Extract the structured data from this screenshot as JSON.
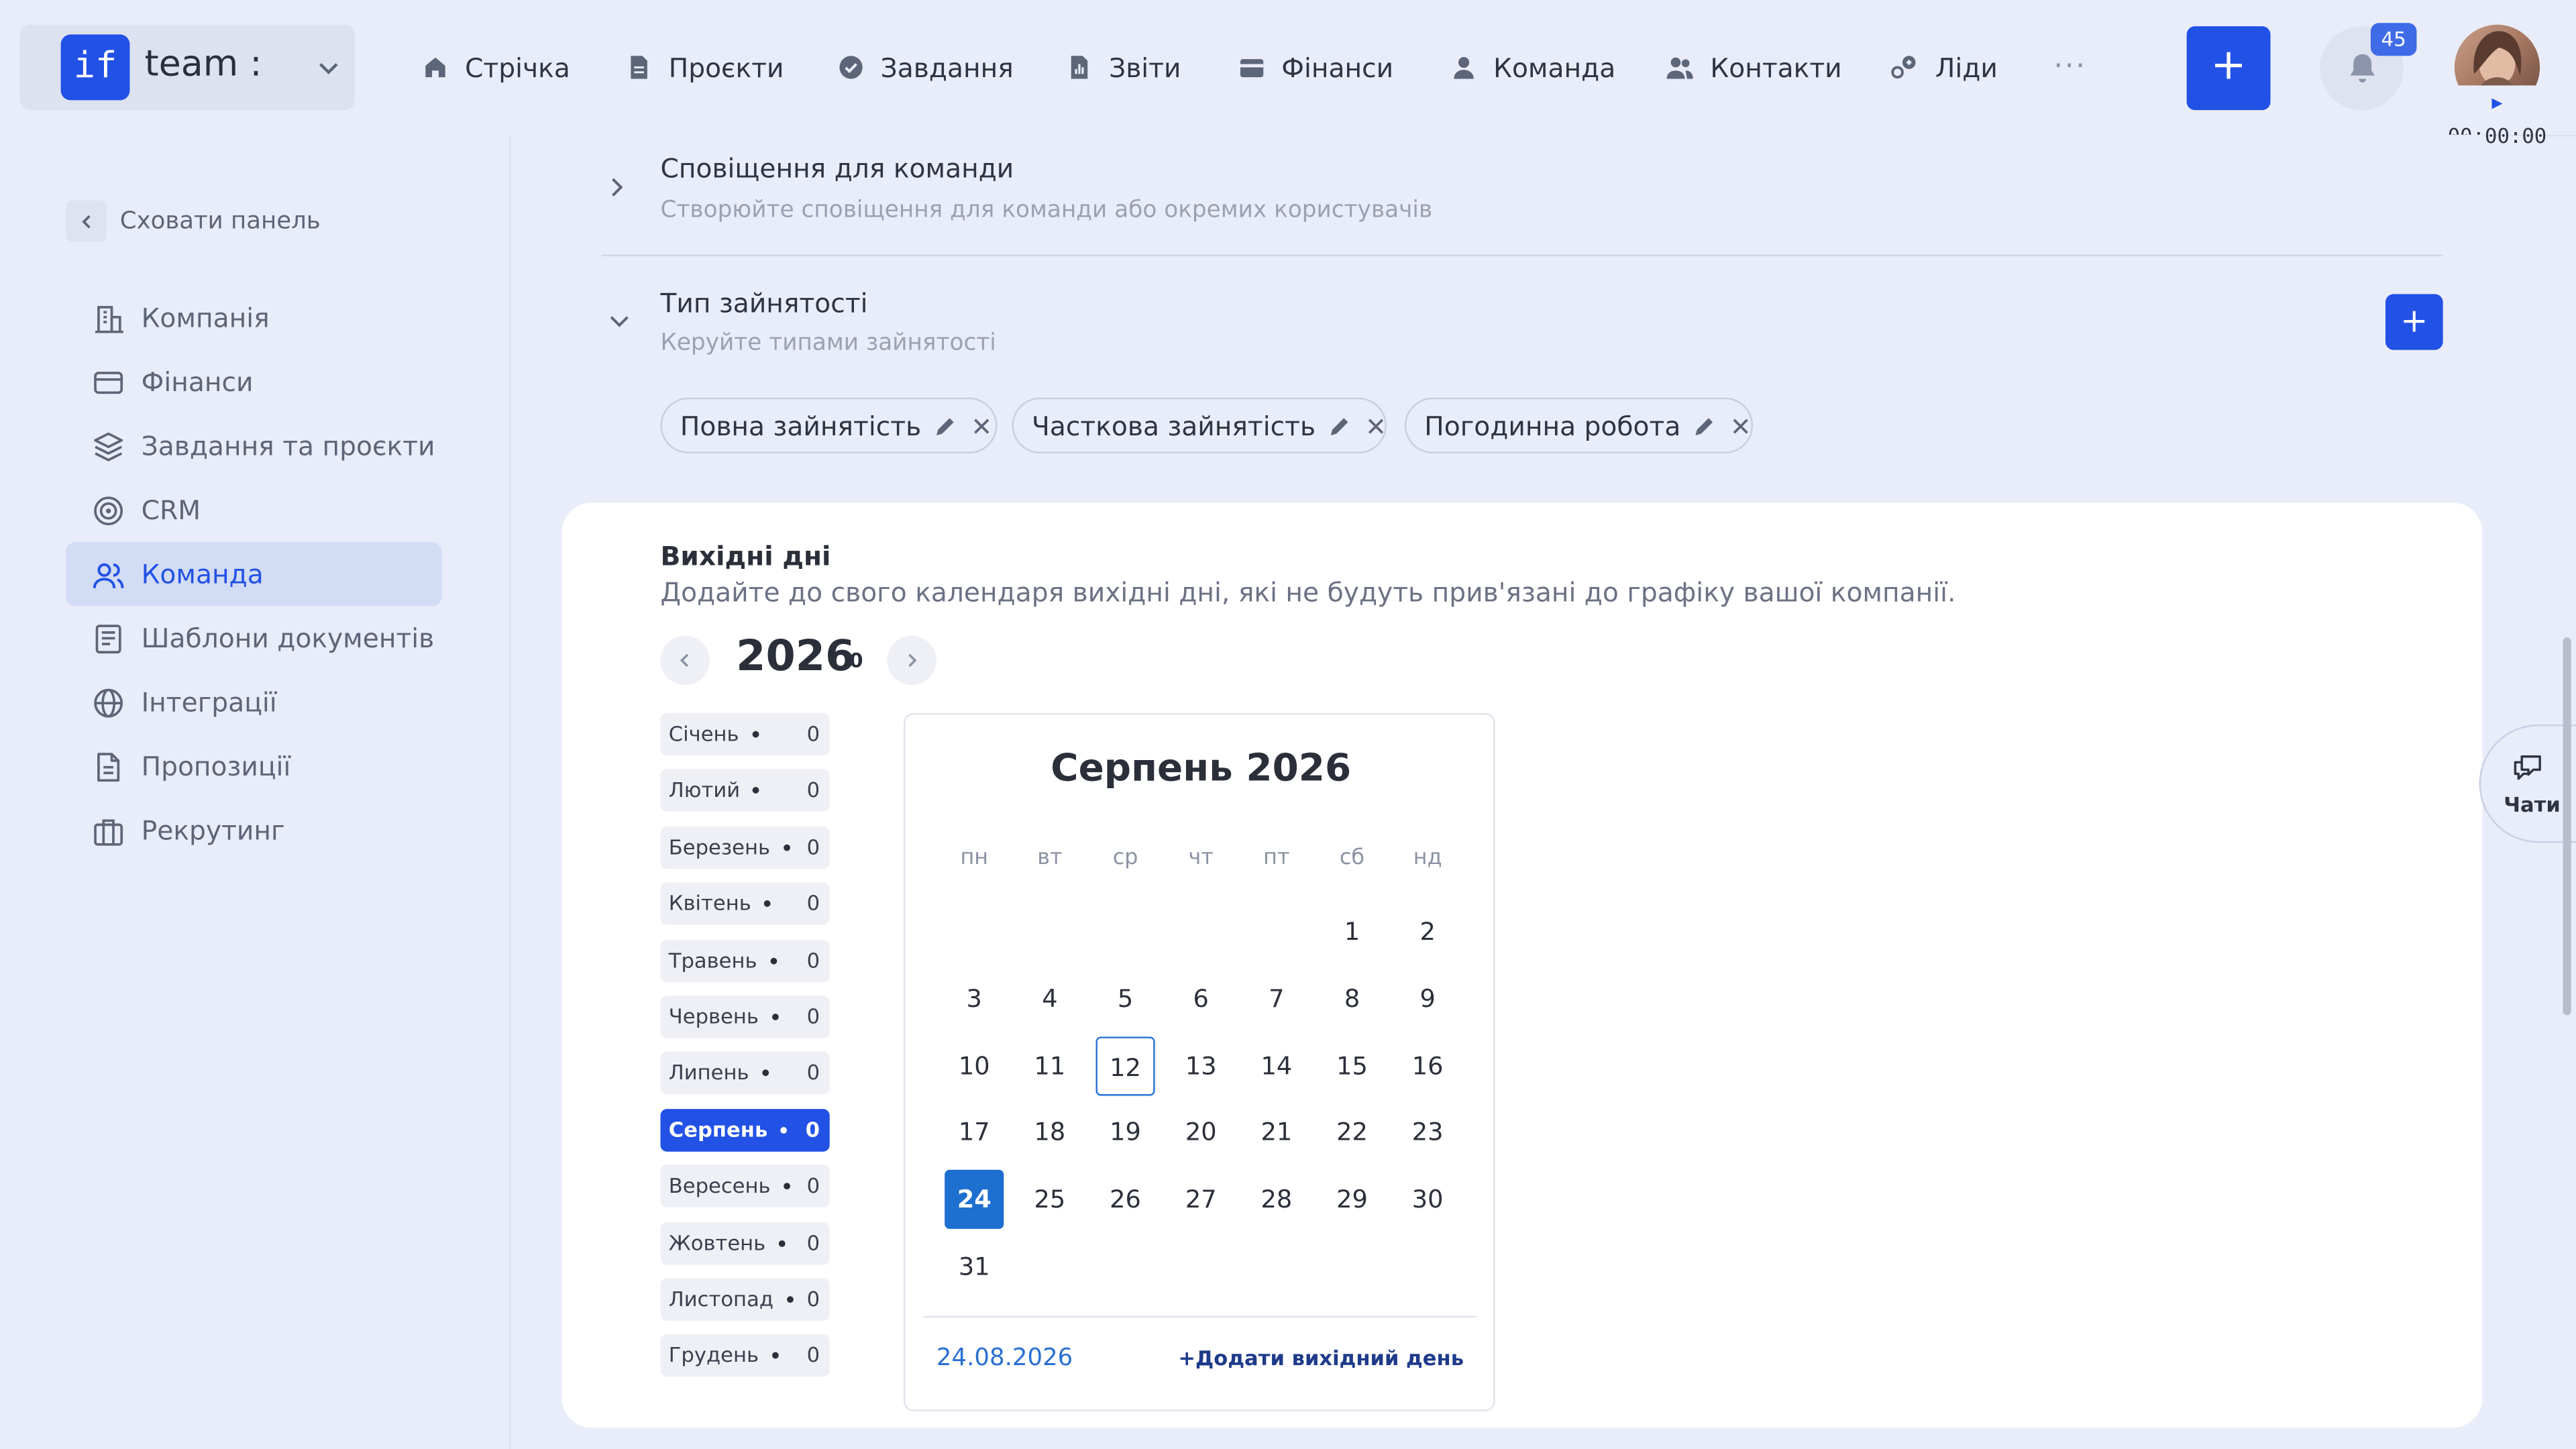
{
  "brand": {
    "logo": "if",
    "name": "team :"
  },
  "nav": [
    {
      "label": "Стрічка",
      "icon": "home-icon"
    },
    {
      "label": "Проєкти",
      "icon": "file-icon"
    },
    {
      "label": "Завдання",
      "icon": "check-circle-icon"
    },
    {
      "label": "Звіти",
      "icon": "report-icon"
    },
    {
      "label": "Фінанси",
      "icon": "wallet-icon"
    },
    {
      "label": "Команда",
      "icon": "user-icon"
    },
    {
      "label": "Контакти",
      "icon": "contacts-icon"
    },
    {
      "label": "Ліди",
      "icon": "leads-icon"
    }
  ],
  "header": {
    "more": "···",
    "add_button": "+",
    "notifications_count": "45",
    "timer": "00:00:00"
  },
  "sidebar": {
    "hide_label": "Сховати панель",
    "items": [
      {
        "label": "Компанія",
        "icon": "company-icon"
      },
      {
        "label": "Фінанси",
        "icon": "card-icon"
      },
      {
        "label": "Завдання та проєкти",
        "icon": "layers-icon"
      },
      {
        "label": "CRM",
        "icon": "target-icon"
      },
      {
        "label": "Команда",
        "icon": "team-icon",
        "active": true
      },
      {
        "label": "Шаблони документів",
        "icon": "template-icon"
      },
      {
        "label": "Інтеграції",
        "icon": "globe-icon"
      },
      {
        "label": "Пропозиції",
        "icon": "document-icon"
      },
      {
        "label": "Рекрутинг",
        "icon": "briefcase-icon"
      }
    ]
  },
  "notifications_section": {
    "title": "Сповіщення для команди",
    "subtitle": "Створюйте сповіщення для команди або окремих користувачів"
  },
  "employment_section": {
    "title": "Тип зайнятості",
    "subtitle": "Керуйте типами зайнятості",
    "add_button": "+",
    "types": [
      "Повна зайнятість",
      "Часткова зайнятість",
      "Погодинна робота"
    ]
  },
  "days_off": {
    "title": "Вихідні дні",
    "subtitle": "Додайте до свого календаря вихідні дні, які не будуть прив'язані до графіку вашої компанії.",
    "year": "2026",
    "year_count": "0",
    "months": [
      {
        "name": "Січень",
        "count": "0"
      },
      {
        "name": "Лютий",
        "count": "0"
      },
      {
        "name": "Березень",
        "count": "0"
      },
      {
        "name": "Квітень",
        "count": "0"
      },
      {
        "name": "Травень",
        "count": "0"
      },
      {
        "name": "Червень",
        "count": "0"
      },
      {
        "name": "Липень",
        "count": "0"
      },
      {
        "name": "Серпень",
        "count": "0",
        "active": true
      },
      {
        "name": "Вересень",
        "count": "0"
      },
      {
        "name": "Жовтень",
        "count": "0"
      },
      {
        "name": "Листопад",
        "count": "0"
      },
      {
        "name": "Грудень",
        "count": "0"
      }
    ],
    "calendar": {
      "title": "Серпень 2026",
      "weekdays": [
        "пн",
        "вт",
        "ср",
        "чт",
        "пт",
        "сб",
        "нд"
      ],
      "first_weekday_index": 5,
      "days_in_month": 31,
      "today": 12,
      "selected": 24,
      "selected_date": "24.08.2026",
      "add_label": "+Додати вихідний день"
    }
  },
  "chat": {
    "label": "Чати"
  },
  "colors": {
    "accent": "#2251e6",
    "background": "#e9edf9",
    "selected_day": "#1d6fd0"
  }
}
